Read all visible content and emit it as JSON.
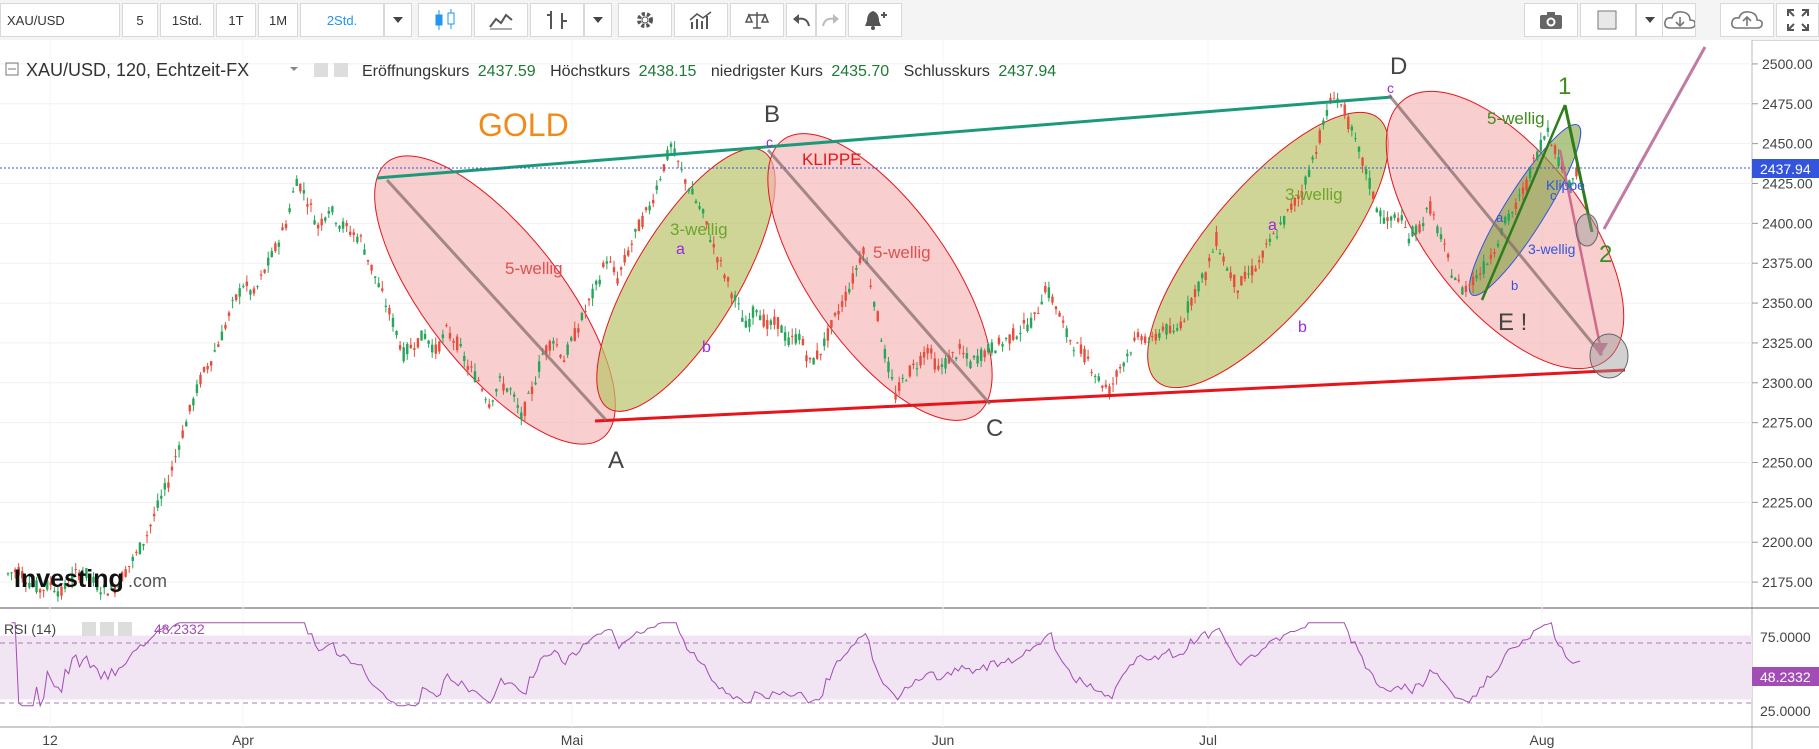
{
  "toolbar": {
    "symbol": "XAU/USD",
    "intervals": [
      "5",
      "1Std.",
      "1T",
      "1M",
      "2Std."
    ],
    "active_interval": "2Std.",
    "icons": [
      "dropdown-icon",
      "candles-icon",
      "line-chart-icon",
      "bars-compare-icon",
      "dropdown-icon",
      "gear-icon",
      "indicators-icon",
      "scales-icon",
      "undo-icon",
      "redo-icon",
      "alert-icon",
      "camera-icon",
      "color-box-icon",
      "dropdown-icon",
      "cloud-download-icon",
      "cloud-upload-icon",
      "fullscreen-icon"
    ]
  },
  "legend": {
    "title": "XAU/USD, 120, Echtzeit-FX",
    "open_label": "Eröffnungskurs",
    "open_value": "2437.59",
    "high_label": "Höchstkurs",
    "high_value": "2438.15",
    "low_label": "niedrigster Kurs",
    "low_value": "2435.70",
    "close_label": "Schlusskurs",
    "close_value": "2437.94"
  },
  "watermark": {
    "brand": "Investing",
    "suffix": ".com"
  },
  "annotations": {
    "gold": "GOLD",
    "klippe_upper": "KLIPPE",
    "klippe_lower": "Klippe",
    "wave_labels": [
      "5-wellig",
      "3-wellig",
      "5-wellig",
      "3-wellig",
      "5-wellig",
      "3-wellig"
    ],
    "points": [
      "A",
      "B",
      "C",
      "D",
      "E !",
      "1",
      "2"
    ],
    "sub_waves": [
      "a",
      "b",
      "c",
      "a",
      "b",
      "c",
      "a",
      "b",
      "c"
    ]
  },
  "rsi": {
    "label": "RSI (14)",
    "value": "48.2332",
    "levels": [
      "75.0000",
      "25.0000"
    ],
    "current_badge": "48.2332"
  },
  "colors": {
    "up": "#26a65b",
    "down": "#e74c3c",
    "rsi": "#a24db5",
    "rsi_band": "#f1e4f3",
    "channel_upper": "#1a9a7a",
    "channel_lower": "#e8141b",
    "red_ellipse": "#f4b3b3",
    "green_ellipse": "#b9c36a",
    "close_line": "#3355dd"
  },
  "chart_data": {
    "type": "candlestick",
    "symbol": "XAU/USD",
    "interval": "120",
    "x_tick_labels": [
      "12",
      "Apr",
      "Mai",
      "Jun",
      "Jul",
      "Aug"
    ],
    "y_tick_labels": [
      "2500.00",
      "2475.00",
      "2450.00",
      "2425.00",
      "2400.00",
      "2375.00",
      "2350.00",
      "2325.00",
      "2300.00",
      "2275.00",
      "2250.00",
      "2225.00",
      "2200.00",
      "2175.00"
    ],
    "ylim": [
      2160,
      2515
    ],
    "last_close": 2437.94,
    "price_path": [
      [
        0,
        2180
      ],
      [
        6,
        2183
      ],
      [
        12,
        2175
      ],
      [
        18,
        2170
      ],
      [
        24,
        2174
      ],
      [
        30,
        2168
      ],
      [
        36,
        2178
      ],
      [
        42,
        2182
      ],
      [
        48,
        2175
      ],
      [
        54,
        2170
      ],
      [
        60,
        2172
      ],
      [
        66,
        2182
      ],
      [
        72,
        2192
      ],
      [
        78,
        2205
      ],
      [
        84,
        2222
      ],
      [
        90,
        2238
      ],
      [
        96,
        2262
      ],
      [
        102,
        2282
      ],
      [
        108,
        2302
      ],
      [
        114,
        2315
      ],
      [
        120,
        2330
      ],
      [
        126,
        2348
      ],
      [
        132,
        2362
      ],
      [
        138,
        2355
      ],
      [
        144,
        2370
      ],
      [
        150,
        2384
      ],
      [
        156,
        2400
      ],
      [
        162,
        2428
      ],
      [
        168,
        2415
      ],
      [
        174,
        2398
      ],
      [
        180,
        2410
      ],
      [
        186,
        2400
      ],
      [
        192,
        2395
      ],
      [
        198,
        2390
      ],
      [
        204,
        2372
      ],
      [
        210,
        2355
      ],
      [
        216,
        2338
      ],
      [
        222,
        2318
      ],
      [
        228,
        2325
      ],
      [
        234,
        2330
      ],
      [
        240,
        2320
      ],
      [
        246,
        2332
      ],
      [
        252,
        2325
      ],
      [
        258,
        2310
      ],
      [
        264,
        2302
      ],
      [
        270,
        2288
      ],
      [
        276,
        2300
      ],
      [
        282,
        2295
      ],
      [
        288,
        2278
      ],
      [
        294,
        2295
      ],
      [
        300,
        2318
      ],
      [
        306,
        2328
      ],
      [
        312,
        2315
      ],
      [
        318,
        2330
      ],
      [
        324,
        2345
      ],
      [
        330,
        2360
      ],
      [
        336,
        2378
      ],
      [
        342,
        2365
      ],
      [
        348,
        2382
      ],
      [
        354,
        2398
      ],
      [
        360,
        2410
      ],
      [
        366,
        2430
      ],
      [
        372,
        2448
      ],
      [
        378,
        2432
      ],
      [
        384,
        2418
      ],
      [
        390,
        2405
      ],
      [
        396,
        2385
      ],
      [
        402,
        2368
      ],
      [
        408,
        2352
      ],
      [
        414,
        2335
      ],
      [
        420,
        2348
      ],
      [
        426,
        2335
      ],
      [
        432,
        2338
      ],
      [
        438,
        2325
      ],
      [
        444,
        2330
      ],
      [
        450,
        2312
      ],
      [
        456,
        2320
      ],
      [
        462,
        2335
      ],
      [
        468,
        2350
      ],
      [
        474,
        2365
      ],
      [
        480,
        2385
      ],
      [
        486,
        2352
      ],
      [
        492,
        2318
      ],
      [
        498,
        2292
      ],
      [
        504,
        2305
      ],
      [
        510,
        2312
      ],
      [
        516,
        2322
      ],
      [
        522,
        2308
      ],
      [
        528,
        2315
      ],
      [
        534,
        2320
      ],
      [
        540,
        2312
      ],
      [
        546,
        2318
      ],
      [
        552,
        2322
      ],
      [
        558,
        2325
      ],
      [
        564,
        2330
      ],
      [
        570,
        2335
      ],
      [
        576,
        2340
      ],
      [
        582,
        2360
      ],
      [
        588,
        2348
      ],
      [
        594,
        2330
      ],
      [
        600,
        2322
      ],
      [
        606,
        2315
      ],
      [
        612,
        2302
      ],
      [
        618,
        2295
      ],
      [
        624,
        2310
      ],
      [
        630,
        2322
      ],
      [
        636,
        2330
      ],
      [
        642,
        2325
      ],
      [
        648,
        2335
      ],
      [
        654,
        2330
      ],
      [
        660,
        2342
      ],
      [
        666,
        2358
      ],
      [
        672,
        2368
      ],
      [
        678,
        2390
      ],
      [
        684,
        2372
      ],
      [
        690,
        2360
      ],
      [
        696,
        2368
      ],
      [
        702,
        2375
      ],
      [
        708,
        2388
      ],
      [
        714,
        2398
      ],
      [
        720,
        2410
      ],
      [
        726,
        2420
      ],
      [
        732,
        2440
      ],
      [
        738,
        2462
      ],
      [
        744,
        2482
      ],
      [
        750,
        2470
      ],
      [
        756,
        2450
      ],
      [
        762,
        2432
      ],
      [
        768,
        2410
      ],
      [
        774,
        2400
      ],
      [
        780,
        2405
      ],
      [
        786,
        2392
      ],
      [
        792,
        2398
      ],
      [
        798,
        2410
      ],
      [
        804,
        2390
      ],
      [
        810,
        2370
      ],
      [
        816,
        2358
      ],
      [
        822,
        2365
      ],
      [
        828,
        2372
      ],
      [
        834,
        2385
      ],
      [
        840,
        2400
      ],
      [
        846,
        2410
      ],
      [
        852,
        2425
      ],
      [
        858,
        2445
      ],
      [
        864,
        2460
      ],
      [
        870,
        2440
      ],
      [
        876,
        2425
      ],
      [
        882,
        2437.94
      ]
    ],
    "rsi_series": {
      "name": "RSI (14)",
      "last": 48.2332,
      "levels": [
        75,
        25
      ]
    },
    "labels": {
      "A": [
        258,
        2278
      ],
      "B": [
        372,
        2448
      ],
      "C": [
        498,
        2290
      ],
      "D": [
        744,
        2482
      ],
      "E !": [
        810,
        2356
      ]
    }
  }
}
